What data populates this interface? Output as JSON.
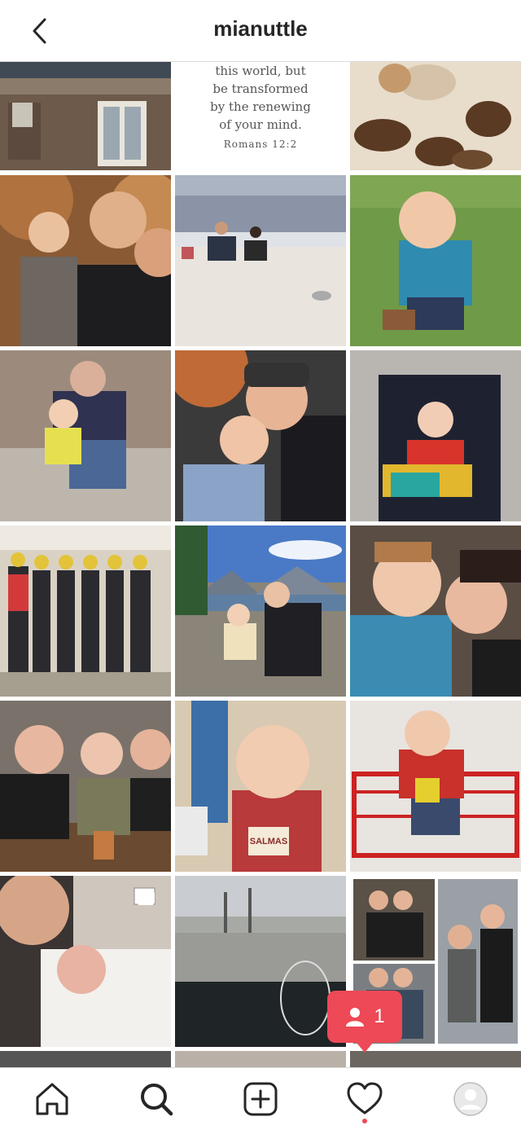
{
  "header": {
    "title": "mianuttle",
    "back_icon": "chevron-left-icon"
  },
  "grid": {
    "quote_lines": [
      "this world, but",
      "be transformed",
      "by the renewing",
      "of your mind."
    ],
    "quote_ref": "Romans 12:2",
    "cup_text": "SALMAS"
  },
  "notification": {
    "count": "1",
    "icon": "person-icon",
    "color": "#ed4956"
  },
  "tabbar": {
    "items": [
      "home-icon",
      "search-icon",
      "new-post-icon",
      "heart-icon",
      "profile-avatar"
    ],
    "active": "search-icon"
  }
}
